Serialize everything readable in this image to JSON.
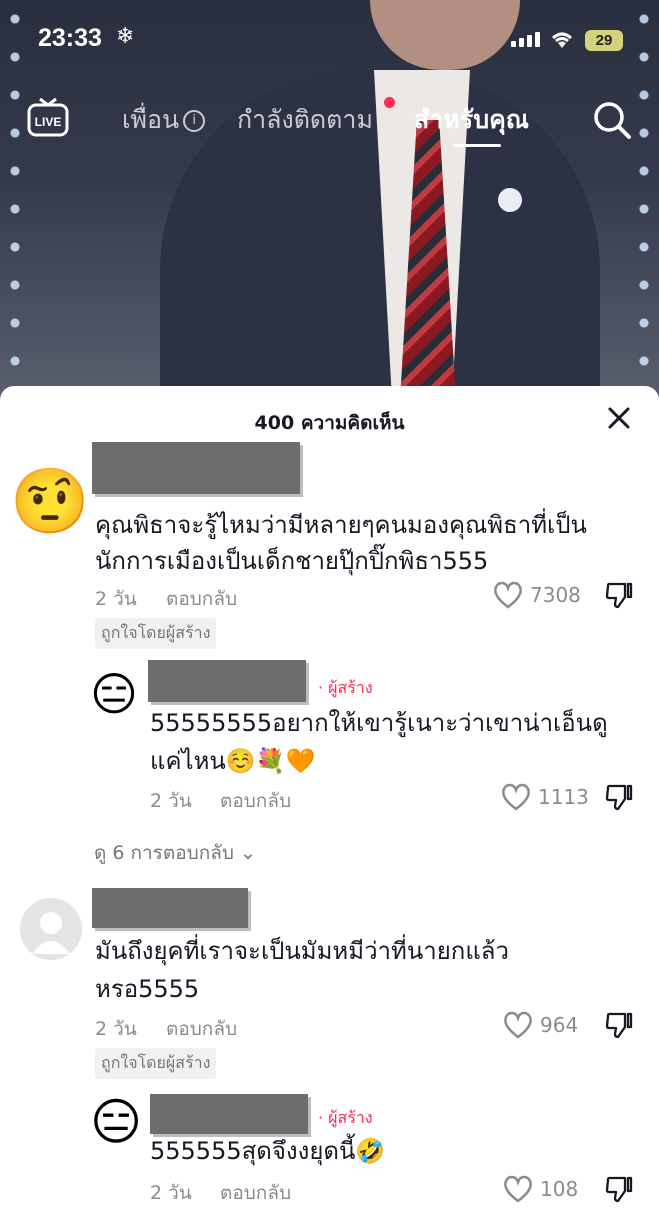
{
  "status_bar": {
    "time": "23:33",
    "battery": "29"
  },
  "top_nav": {
    "live": "LIVE",
    "tabs": [
      "เพื่อน",
      "กำลังติดตาม",
      "สำหรับคุณ"
    ]
  },
  "comments_header": {
    "count_label": "400 ความคิดเห็น"
  },
  "comments": [
    {
      "text_line1": "คุณพิธาจะรู้ไหมว่ามีหลายๆคนมองคุณพิธาที่เป็น",
      "text_line2": "นักการเมืองเป็นเด็กชายปุ๊กปิ๊กพิธา555",
      "age": "2 วัน",
      "reply": "ตอบกลับ",
      "likes": "7308",
      "creator_liked": "ถูกใจโดยผู้สร้าง",
      "avatar_emoji": "🤨"
    },
    {
      "creator_badge": "· ผู้สร้าง",
      "text_line1": "55555555อยากให้เขารู้เนาะว่าเขาน่าเอ็นดู",
      "text_line2": "แค่ไหน☺️💐🧡",
      "age": "2 วัน",
      "reply": "ตอบกลับ",
      "likes": "1113",
      "avatar_emoji": "😑"
    },
    {
      "text_line1": "มันถึงยุคที่เราจะเป็นมัมหมีว่าที่นายกแล้ว",
      "text_line2": "หรอ5555",
      "age": "2 วัน",
      "reply": "ตอบกลับ",
      "likes": "964",
      "creator_liked": "ถูกใจโดยผู้สร้าง"
    },
    {
      "creator_badge": "· ผู้สร้าง",
      "text_line1": "555555สุดจึงงยุดนี้🤣",
      "age": "2 วัน",
      "reply": "ตอบกลับ",
      "likes": "108",
      "avatar_emoji": "😑"
    }
  ],
  "view_replies": "ดู 6 การตอบกลับ",
  "icons": [
    "live-icon",
    "search-icon",
    "close-icon",
    "heart-icon",
    "dislike-icon",
    "chevron-down-icon",
    "info-icon",
    "snowflake-icon",
    "wifi-icon",
    "signal-icon"
  ]
}
